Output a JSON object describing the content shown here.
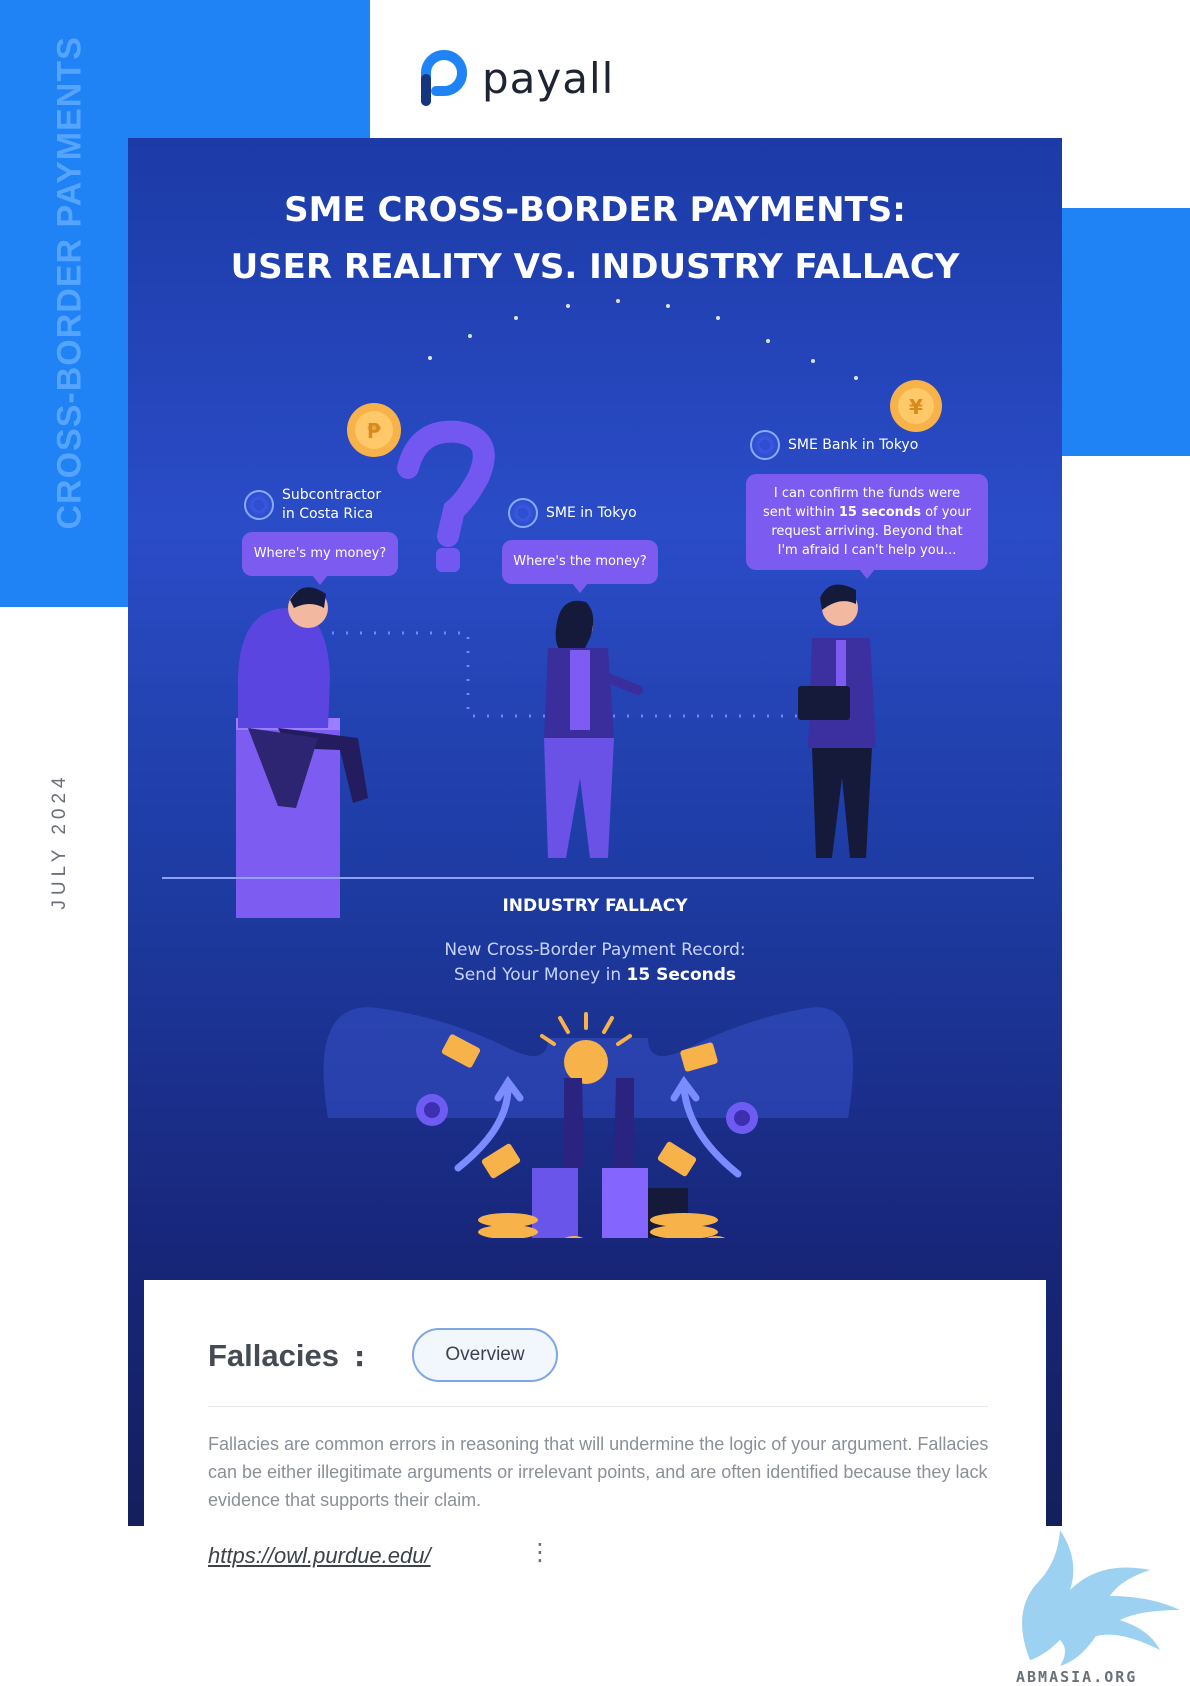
{
  "brand": {
    "name": "payall",
    "accent": "#1f82f5"
  },
  "side_label": "CROSS-BORDER PAYMENTS",
  "date_label": "JULY 2024",
  "headline": {
    "line1": "SME CROSS-BORDER PAYMENTS:",
    "line2": "USER REALITY VS. INDUSTRY FALLACY"
  },
  "characters": {
    "subcontractor": {
      "label_line1": "Subcontractor",
      "label_line2": "in Costa Rica",
      "speech": "Where's my money?"
    },
    "sme": {
      "label": "SME in Tokyo",
      "speech": "Where's the money?"
    },
    "bank": {
      "label": "SME Bank in Tokyo",
      "speech_before": "I can confirm the funds were sent within ",
      "speech_bold": "15 seconds",
      "speech_after": " of your request arriving. Beyond that I'm afraid I can't help you..."
    }
  },
  "industry_fallacy": {
    "heading": "INDUSTRY FALLACY",
    "line1": "New Cross-Border Payment Record:",
    "line2_before": "Send Your Money in ",
    "line2_bold": "15 Seconds"
  },
  "card": {
    "title": "Fallacies",
    "colon": ":",
    "tab_label": "Overview",
    "body": "Fallacies are common errors in reasoning that will undermine the logic of your argument. Fallacies can be either illegitimate arguments or irrelevant points, and are often identified because they lack evidence that supports their claim.",
    "link": "https://owl.purdue.edu/",
    "more_icon": "vertical-dots-icon"
  },
  "watermark": "ABMASIA.ORG",
  "icons": [
    "payall-logo-icon",
    "globe-icon",
    "question-mark-icon",
    "coin-icon",
    "yen-coin-icon",
    "money-bill-icon",
    "target-icon",
    "arrow-up-icon",
    "trophy-coin-icon",
    "dragon-logo-icon"
  ]
}
